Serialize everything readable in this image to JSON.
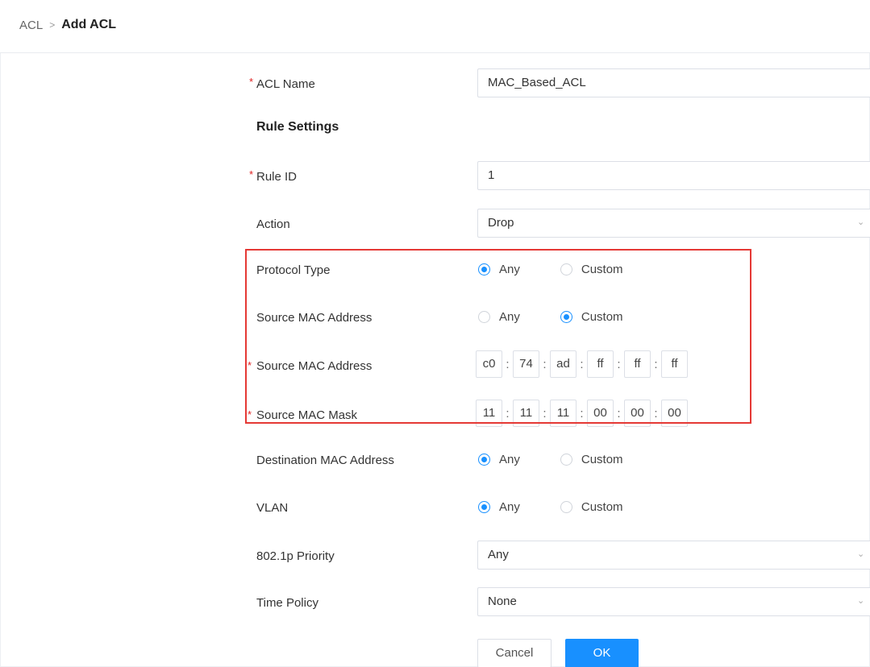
{
  "breadcrumb": {
    "root": "ACL",
    "separator": ">",
    "current": "Add ACL"
  },
  "required_mark": "*",
  "acl_name": {
    "label": "ACL Name",
    "value": "MAC_Based_ACL"
  },
  "rule_settings": {
    "title": "Rule Settings"
  },
  "rule_id": {
    "label": "Rule ID",
    "value": "1"
  },
  "action": {
    "label": "Action",
    "value": "Drop"
  },
  "protocol_type": {
    "label": "Protocol Type",
    "any": "Any",
    "custom": "Custom",
    "selected": "Any"
  },
  "source_mac_mode": {
    "label": "Source MAC Address",
    "any": "Any",
    "custom": "Custom",
    "selected": "Custom"
  },
  "source_mac_address": {
    "label": "Source MAC Address",
    "octets": [
      "c0",
      "74",
      "ad",
      "ff",
      "ff",
      "ff"
    ],
    "separator": ":"
  },
  "source_mac_mask": {
    "label": "Source MAC Mask",
    "octets": [
      "11",
      "11",
      "11",
      "00",
      "00",
      "00"
    ],
    "separator": ":"
  },
  "destination_mac": {
    "label": "Destination MAC Address",
    "any": "Any",
    "custom": "Custom",
    "selected": "Any"
  },
  "vlan": {
    "label": "VLAN",
    "any": "Any",
    "custom": "Custom",
    "selected": "Any"
  },
  "priority": {
    "label": "802.1p Priority",
    "value": "Any"
  },
  "time_policy": {
    "label": "Time Policy",
    "value": "None"
  },
  "buttons": {
    "cancel": "Cancel",
    "ok": "OK"
  },
  "colors": {
    "accent": "#1890ff",
    "highlight": "#e53935",
    "required": "#e02020"
  },
  "icons": {
    "dropdown": "chevron-down-icon",
    "breadcrumb_separator": "chevron-right-icon"
  }
}
